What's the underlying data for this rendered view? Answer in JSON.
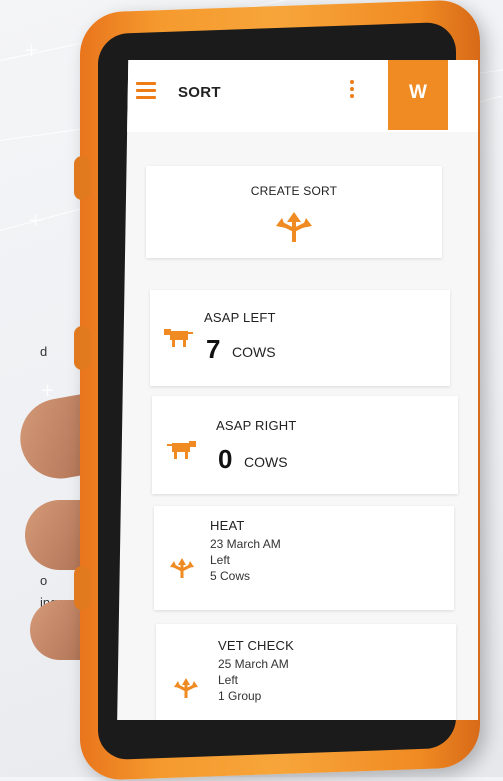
{
  "background": {
    "side_text": [
      "d",
      "o",
      "ing"
    ]
  },
  "app": {
    "header": {
      "title": "SORT",
      "brand_button": "W"
    },
    "create_sort": {
      "label": "CREATE SORT"
    },
    "asap_left": {
      "label": "ASAP LEFT",
      "count": "7",
      "unit": "COWS"
    },
    "asap_right": {
      "label": "ASAP RIGHT",
      "count": "0",
      "unit": "COWS"
    },
    "sorts": [
      {
        "label": "HEAT",
        "date": "23 March AM",
        "direction": "Left",
        "amount": "5 Cows"
      },
      {
        "label": "VET CHECK",
        "date": "25 March AM",
        "direction": "Left",
        "amount": "1 Group"
      }
    ]
  },
  "colors": {
    "accent": "#F08A22",
    "case": "#F59A2E"
  },
  "icons": [
    "menu-icon",
    "kebab-icon",
    "split-arrows-icon",
    "cow-icon",
    "sort-arrows-icon"
  ]
}
